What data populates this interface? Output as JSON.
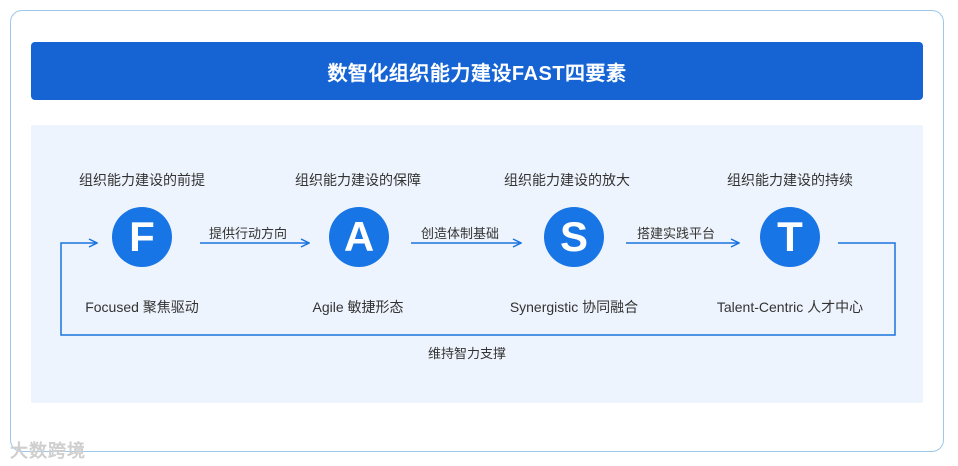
{
  "title": "数智化组织能力建设FAST四要素",
  "elements": [
    {
      "top": "组织能力建设的前提",
      "letter": "F",
      "bottom": "Focused 聚焦驱动"
    },
    {
      "top": "组织能力建设的保障",
      "letter": "A",
      "bottom": "Agile 敏捷形态"
    },
    {
      "top": "组织能力建设的放大",
      "letter": "S",
      "bottom": "Synergistic 协同融合"
    },
    {
      "top": "组织能力建设的持续",
      "letter": "T",
      "bottom": "Talent-Centric 人才中心"
    }
  ],
  "arrows": [
    "提供行动方向",
    "创造体制基础",
    "搭建实践平台"
  ],
  "loop_label": "维持智力支撑",
  "watermark": "大数跨境",
  "colors": {
    "title_bg": "#1664d4",
    "circle": "#1775e6",
    "line": "#1a73e0",
    "panel": "#eef4fd"
  }
}
